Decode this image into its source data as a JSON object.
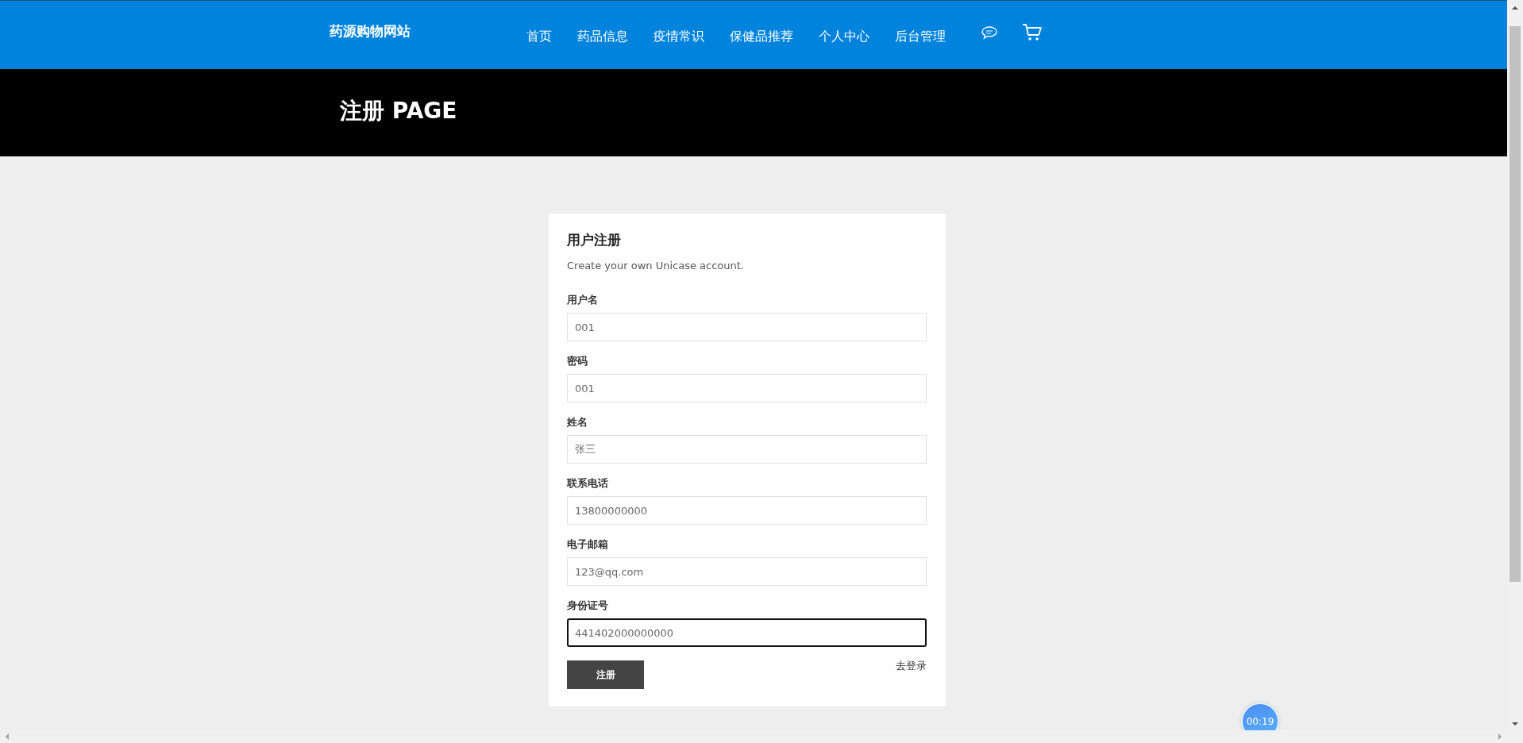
{
  "header": {
    "logo": "药源购物网站",
    "nav": [
      {
        "label": "首页"
      },
      {
        "label": "药品信息"
      },
      {
        "label": "疫情常识"
      },
      {
        "label": "保健品推荐"
      },
      {
        "label": "个人中心"
      },
      {
        "label": "后台管理"
      }
    ]
  },
  "banner": {
    "title": "注册 PAGE"
  },
  "form": {
    "title": "用户注册",
    "subtitle": "Create your own Unicase account.",
    "fields": [
      {
        "label": "用户名",
        "value": "001",
        "focused": false
      },
      {
        "label": "密码",
        "value": "001",
        "focused": false
      },
      {
        "label": "姓名",
        "value": "张三",
        "focused": false
      },
      {
        "label": "联系电话",
        "value": "13800000000",
        "focused": false
      },
      {
        "label": "电子邮箱",
        "value": "123@qq.com",
        "focused": false
      },
      {
        "label": "身份证号",
        "value": "441402000000000",
        "focused": true
      }
    ],
    "submit": "注册",
    "login_link": "去登录"
  },
  "timer": "00:19"
}
